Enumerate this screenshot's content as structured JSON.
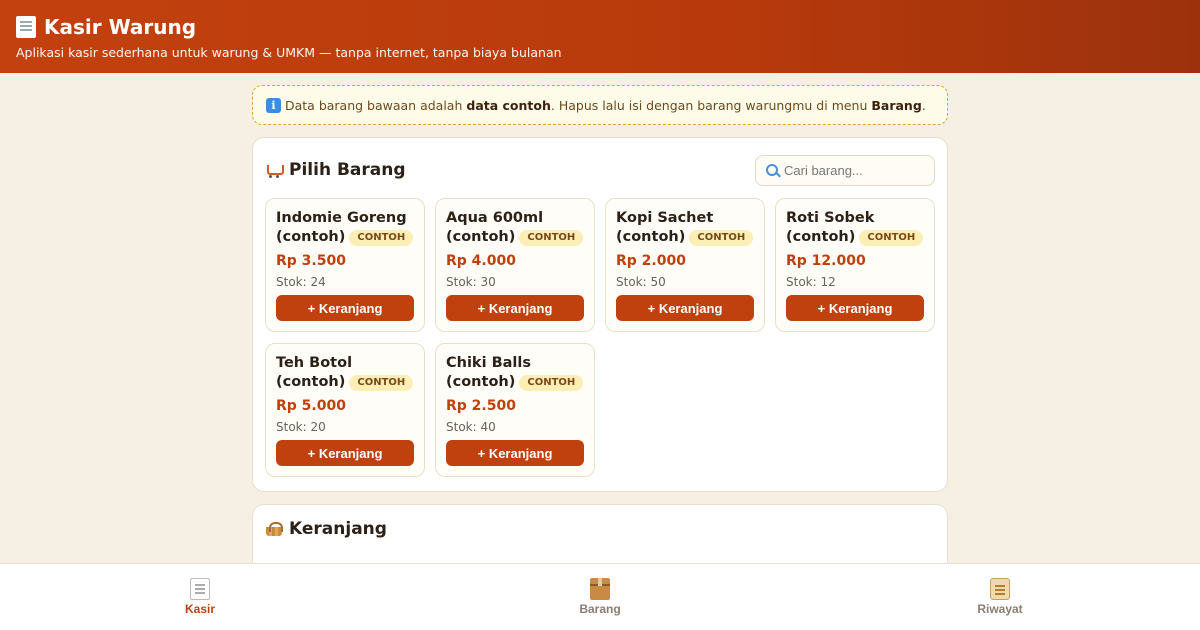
{
  "header": {
    "title": "Kasir Warung",
    "subtitle": "Aplikasi kasir sederhana untuk warung & UMKM — tanpa internet, tanpa biaya bulanan"
  },
  "notice": {
    "text_before": "Data barang bawaan adalah ",
    "bold_1": "data contoh",
    "text_middle": ". Hapus lalu isi dengan barang warungmu di menu ",
    "bold_2": "Barang",
    "text_after": "."
  },
  "products_section": {
    "title": "Pilih Barang",
    "search_placeholder": "Cari barang...",
    "items": [
      {
        "name": "Indomie Goreng (contoh)",
        "badge": "CONTOH",
        "price": "Rp 3.500",
        "stock": "Stok: 24",
        "button": "+ Keranjang"
      },
      {
        "name": "Aqua 600ml (contoh)",
        "badge": "CONTOH",
        "price": "Rp 4.000",
        "stock": "Stok: 30",
        "button": "+ Keranjang"
      },
      {
        "name": "Kopi Sachet (contoh)",
        "badge": "CONTOH",
        "price": "Rp 2.000",
        "stock": "Stok: 50",
        "button": "+ Keranjang"
      },
      {
        "name": "Roti Sobek (contoh)",
        "badge": "CONTOH",
        "price": "Rp 12.000",
        "stock": "Stok: 12",
        "button": "+ Keranjang"
      },
      {
        "name": "Teh Botol (contoh)",
        "badge": "CONTOH",
        "price": "Rp 5.000",
        "stock": "Stok: 20",
        "button": "+ Keranjang"
      },
      {
        "name": "Chiki Balls (contoh)",
        "badge": "CONTOH",
        "price": "Rp 2.500",
        "stock": "Stok: 40",
        "button": "+ Keranjang"
      }
    ]
  },
  "cart_section": {
    "title": "Keranjang"
  },
  "bottom_nav": {
    "items": [
      {
        "label": "Kasir",
        "icon": "receipt-icon",
        "active": true
      },
      {
        "label": "Barang",
        "icon": "box-icon",
        "active": false
      },
      {
        "label": "Riwayat",
        "icon": "scroll-icon",
        "active": false
      }
    ]
  },
  "colors": {
    "accent": "#c0410d",
    "header_gradient_end": "#9c320d",
    "background": "#f5efe4",
    "badge_bg": "#fdeeb6"
  }
}
